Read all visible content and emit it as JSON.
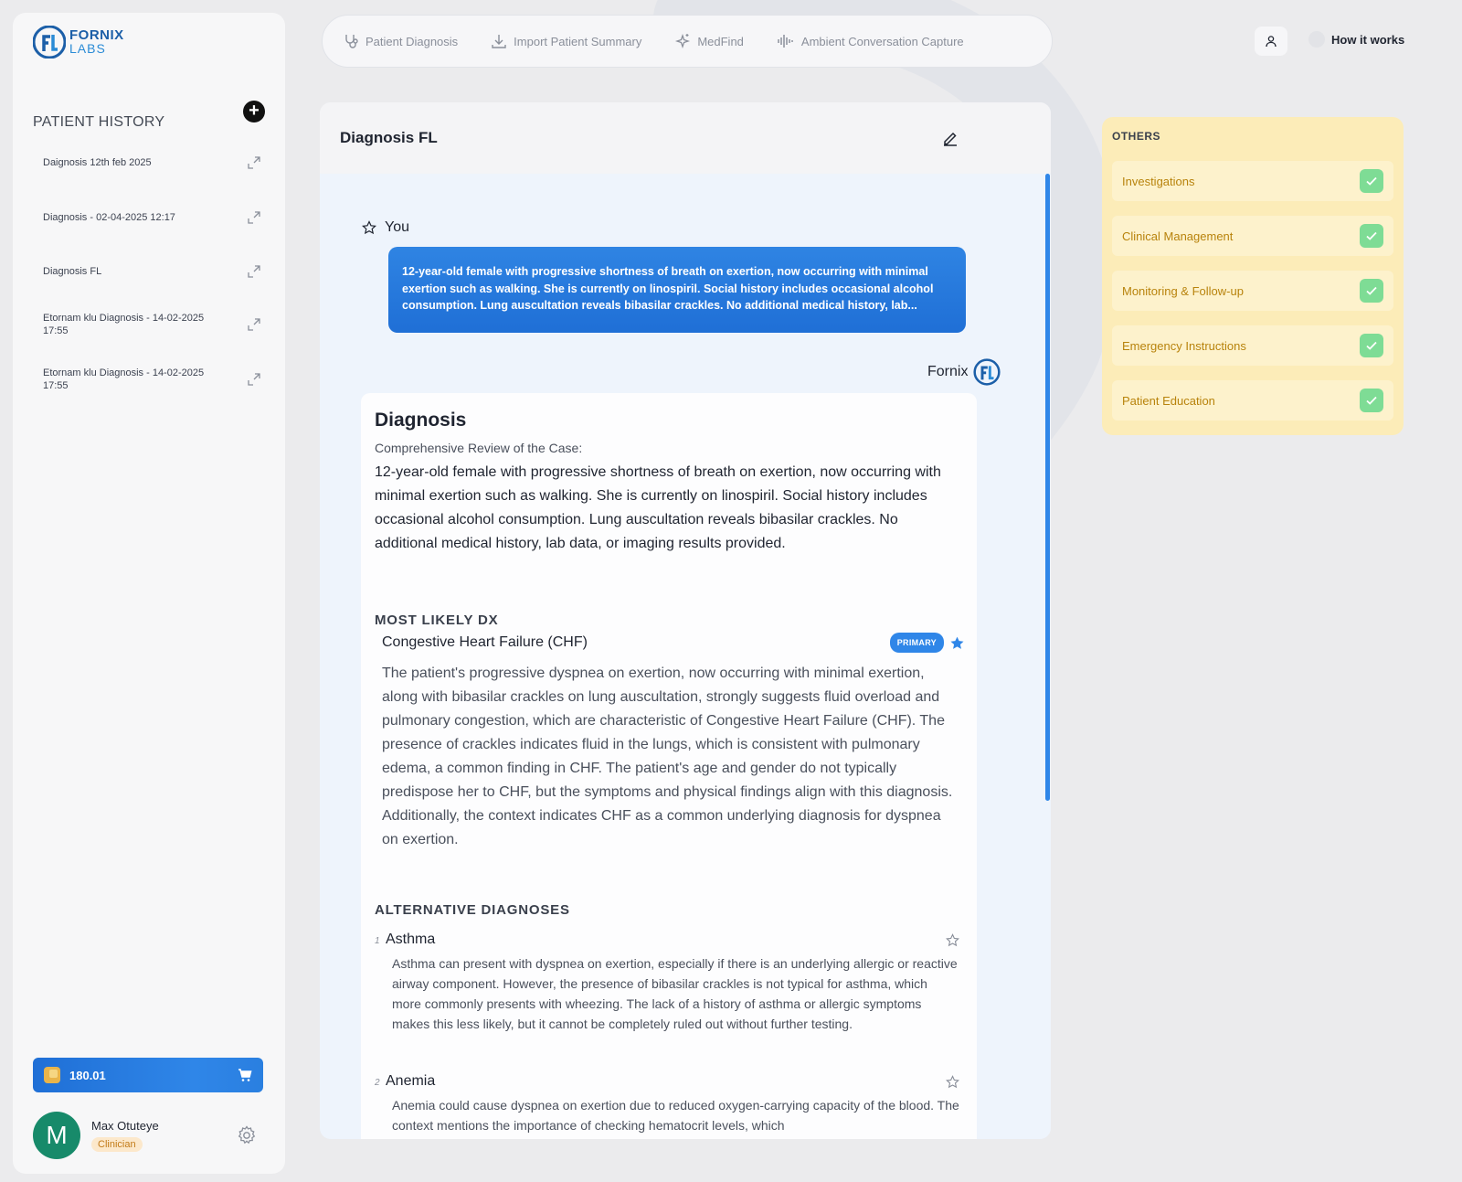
{
  "brand": {
    "line1": "FORNIX",
    "line2": "LABS"
  },
  "sidebar": {
    "title": "PATIENT HISTORY",
    "items": [
      {
        "label": "Daignosis 12th feb 2025"
      },
      {
        "label": "Diagnosis - 02-04-2025 12:17"
      },
      {
        "label": "Diagnosis FL"
      },
      {
        "label": "Etornam klu Diagnosis - 14-02-2025 17:55"
      },
      {
        "label": "Etornam klu Diagnosis - 14-02-2025 17:55"
      }
    ],
    "credits": "180.01",
    "user": {
      "initial": "M",
      "name": "Max Otuteye",
      "role": "Clinician"
    }
  },
  "topnav": {
    "items": [
      {
        "label": "Patient Diagnosis",
        "icon": "stethoscope-icon"
      },
      {
        "label": "Import Patient Summary",
        "icon": "download-icon"
      },
      {
        "label": "MedFind",
        "icon": "sparkle-icon"
      },
      {
        "label": "Ambient Conversation Capture",
        "icon": "waveform-icon"
      }
    ],
    "how_it_works": "How it works"
  },
  "main": {
    "title": "Diagnosis FL",
    "you_label": "You",
    "user_message": "12-year-old female with progressive shortness of breath on exertion, now occurring with minimal exertion such as walking. She is currently on linospiril. Social history includes occasional alcohol consumption. Lung auscultation reveals bibasilar crackles. No additional medical history, lab...",
    "assistant_name": "Fornix",
    "diagnosis": {
      "heading": "Diagnosis",
      "subheading": "Comprehensive Review of the Case:",
      "case_text": "12-year-old female with progressive shortness of breath on exertion, now occurring with minimal exertion such as walking. She is currently on linospiril. Social history includes occasional alcohol consumption. Lung auscultation reveals bibasilar crackles. No additional medical history, lab data, or imaging results provided.",
      "most_likely_title": "MOST LIKELY DX",
      "most_likely": {
        "name": "Congestive Heart Failure (CHF)",
        "badge": "PRIMARY",
        "text": "The patient's progressive dyspnea on exertion, now occurring with minimal exertion, along with bibasilar crackles on lung auscultation, strongly suggests fluid overload and pulmonary congestion, which are characteristic of Congestive Heart Failure (CHF). The presence of crackles indicates fluid in the lungs, which is consistent with pulmonary edema, a common finding in CHF. The patient's age and gender do not typically predispose her to CHF, but the symptoms and physical findings align with this diagnosis. Additionally, the context indicates CHF as a common underlying diagnosis for dyspnea on exertion."
      },
      "alternatives_title": "ALTERNATIVE DIAGNOSES",
      "alternatives": [
        {
          "num": "1",
          "name": "Asthma",
          "text": "Asthma can present with dyspnea on exertion, especially if there is an underlying allergic or reactive airway component. However, the presence of bibasilar crackles is not typical for asthma, which more commonly presents with wheezing. The lack of a history of asthma or allergic symptoms makes this less likely, but it cannot be completely ruled out without further testing."
        },
        {
          "num": "2",
          "name": "Anemia",
          "text": "Anemia could cause dyspnea on exertion due to reduced oxygen-carrying capacity of the blood. The context mentions the importance of checking hematocrit levels, which"
        }
      ]
    }
  },
  "others": {
    "title": "OTHERS",
    "items": [
      {
        "label": "Investigations",
        "checked": true
      },
      {
        "label": "Clinical Management",
        "checked": true
      },
      {
        "label": "Monitoring & Follow-up",
        "checked": true
      },
      {
        "label": "Emergency Instructions",
        "checked": true
      },
      {
        "label": "Patient Education",
        "checked": true
      }
    ]
  },
  "colors": {
    "accent": "#2f86e8",
    "others_bg": "#fcecb8",
    "check": "#7edc95",
    "avatar": "#178a6a"
  }
}
